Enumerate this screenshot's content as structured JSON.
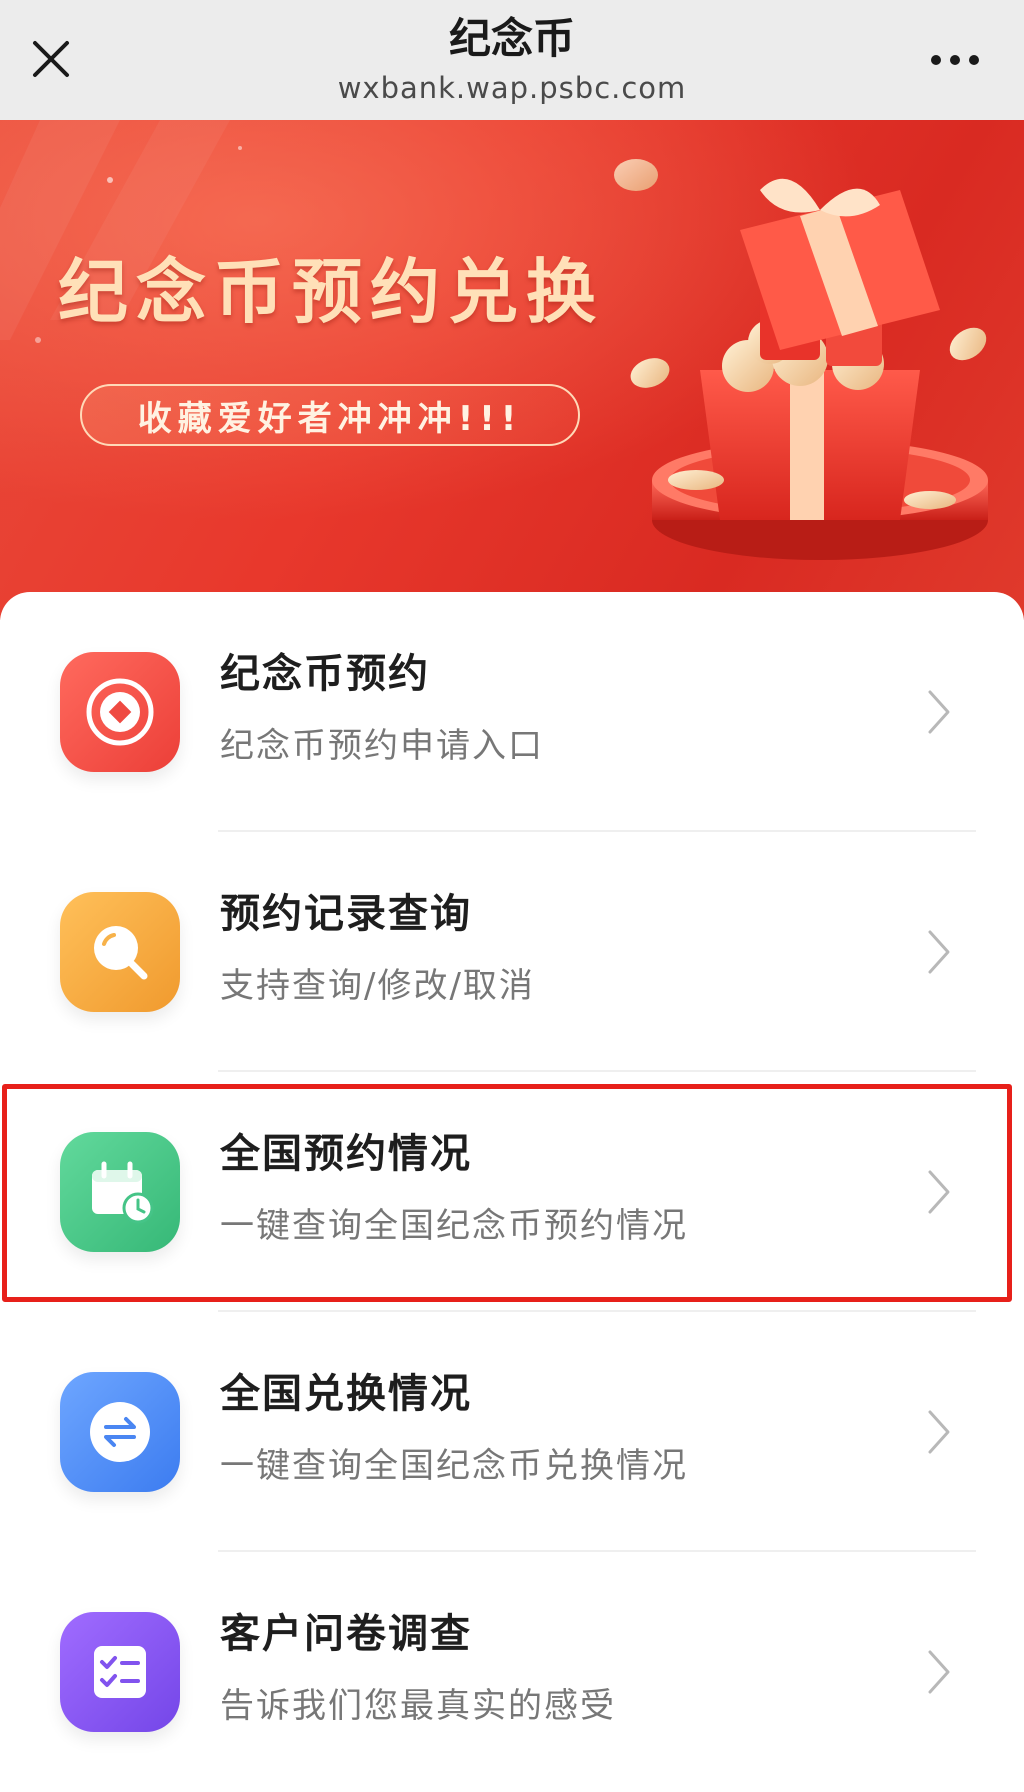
{
  "header": {
    "title": "纪念币",
    "url": "wxbank.wap.psbc.com",
    "close_icon": "close-icon",
    "more_icon": "more-icon"
  },
  "banner": {
    "title": "纪念币预约兑换",
    "slogan": "收藏爱好者冲冲冲!!!",
    "illustration": "gift-box-with-coins"
  },
  "menu": {
    "items": [
      {
        "title": "纪念币预约",
        "subtitle": "纪念币预约申请入口",
        "icon": "coin-icon",
        "icon_color": "#f1554d"
      },
      {
        "title": "预约记录查询",
        "subtitle": "支持查询/修改/取消",
        "icon": "search-icon",
        "icon_color": "#f2a33c"
      },
      {
        "title": "全国预约情况",
        "subtitle": "一键查询全国纪念币预约情况",
        "icon": "calendar-clock-icon",
        "icon_color": "#49c98a"
      },
      {
        "title": "全国兑换情况",
        "subtitle": "一键查询全国纪念币兑换情况",
        "icon": "exchange-icon",
        "icon_color": "#4d8df5"
      },
      {
        "title": "客户问卷调查",
        "subtitle": "告诉我们您最真实的感受",
        "icon": "checklist-icon",
        "icon_color": "#8a55ef"
      }
    ]
  },
  "highlight": {
    "color": "#e7201a"
  }
}
